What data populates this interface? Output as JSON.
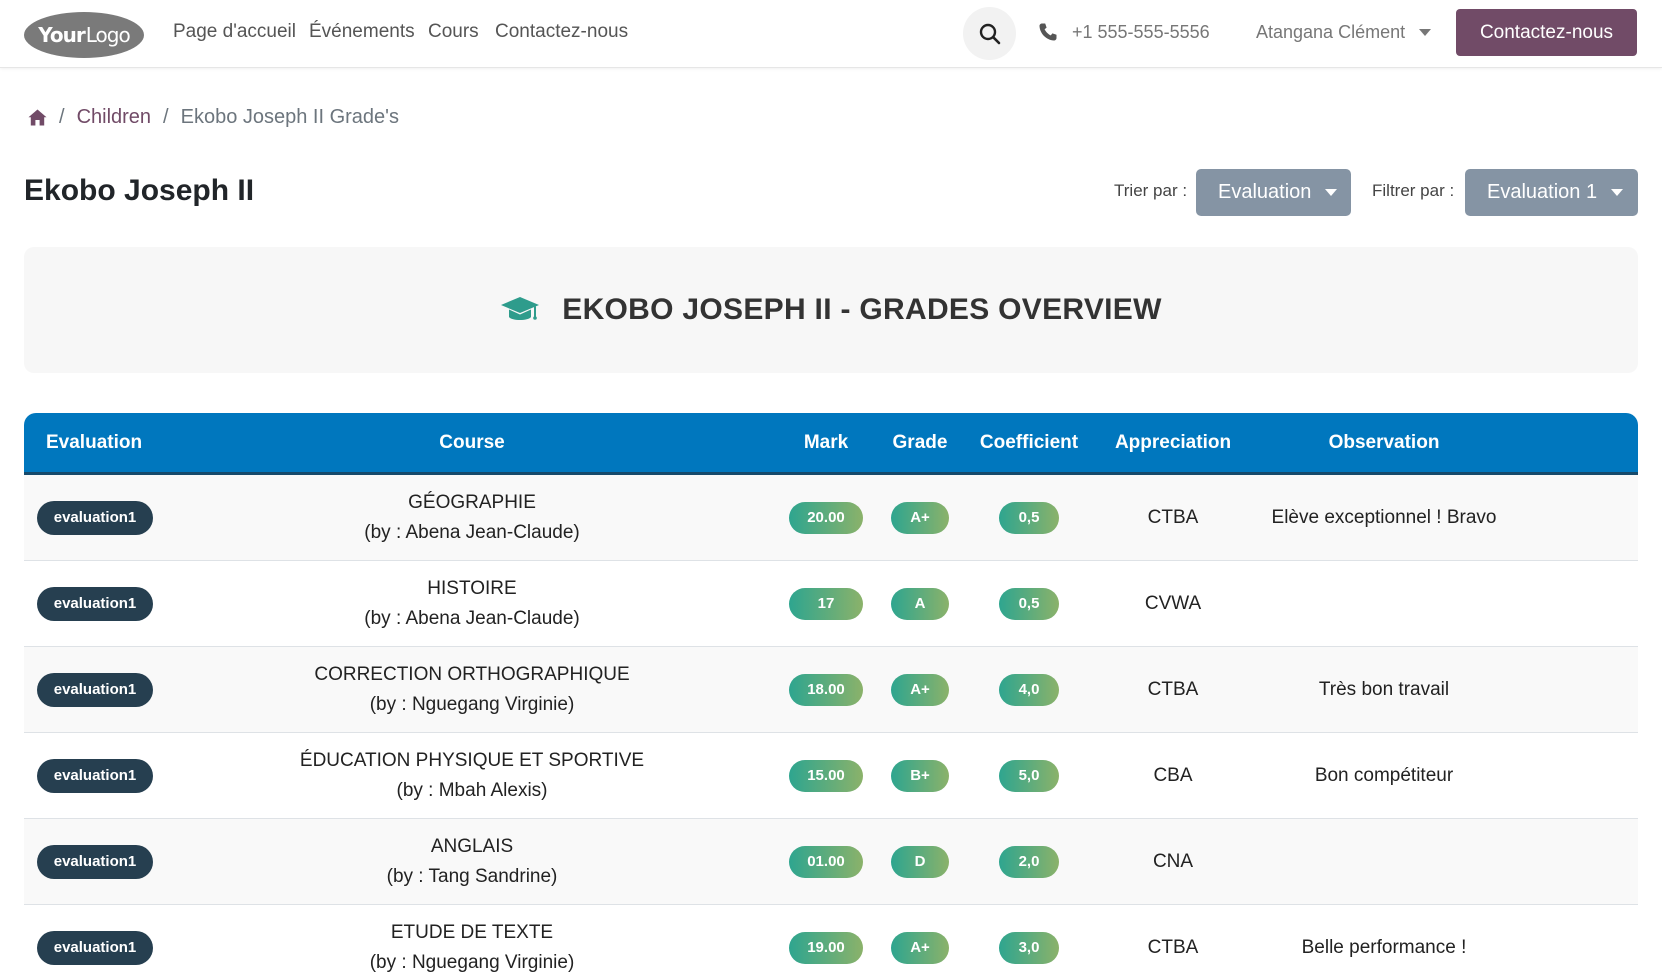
{
  "header": {
    "logo_bold": "Your",
    "logo_light": "Logo",
    "nav": [
      "Page d'accueil",
      "Événements",
      "Cours",
      "Contactez-nous"
    ],
    "phone": "+1 555-555-5556",
    "user": "Atangana Clément",
    "cta": "Contactez-nous"
  },
  "breadcrumb": {
    "children": "Children",
    "current": "Ekobo Joseph II Grade's"
  },
  "page_title": "Ekobo Joseph II",
  "controls": {
    "sort_label": "Trier par :",
    "sort_value": "Evaluation",
    "filter_label": "Filtrer par :",
    "filter_value": "Evaluation 1"
  },
  "overview_title": "EKOBO JOSEPH II - GRADES OVERVIEW",
  "table": {
    "headers": [
      "Evaluation",
      "Course",
      "Mark",
      "Grade",
      "Coefficient",
      "Appreciation",
      "Observation"
    ],
    "rows": [
      {
        "evaluation": "evaluation1",
        "course": "GÉOGRAPHIE",
        "teacher": "(by : Abena Jean-Claude)",
        "mark": "20.00",
        "grade": "A+",
        "coefficient": "0,5",
        "appreciation": "CTBA",
        "observation": "Elève exceptionnel ! Bravo"
      },
      {
        "evaluation": "evaluation1",
        "course": "HISTOIRE",
        "teacher": "(by : Abena Jean-Claude)",
        "mark": "17",
        "grade": "A",
        "coefficient": "0,5",
        "appreciation": "CVWA",
        "observation": ""
      },
      {
        "evaluation": "evaluation1",
        "course": "CORRECTION ORTHOGRAPHIQUE",
        "teacher": "(by : Nguegang Virginie)",
        "mark": "18.00",
        "grade": "A+",
        "coefficient": "4,0",
        "appreciation": "CTBA",
        "observation": "Très bon travail"
      },
      {
        "evaluation": "evaluation1",
        "course": "ÉDUCATION PHYSIQUE ET SPORTIVE",
        "teacher": "(by : Mbah Alexis)",
        "mark": "15.00",
        "grade": "B+",
        "coefficient": "5,0",
        "appreciation": "CBA",
        "observation": "Bon compétiteur"
      },
      {
        "evaluation": "evaluation1",
        "course": "ANGLAIS",
        "teacher": "(by : Tang Sandrine)",
        "mark": "01.00",
        "grade": "D",
        "coefficient": "2,0",
        "appreciation": "CNA",
        "observation": ""
      },
      {
        "evaluation": "evaluation1",
        "course": "ETUDE DE TEXTE",
        "teacher": "(by : Nguegang Virginie)",
        "mark": "19.00",
        "grade": "A+",
        "coefficient": "3,0",
        "appreciation": "CTBA",
        "observation": "Belle performance !"
      }
    ]
  },
  "colors": {
    "brand": "#714b67",
    "table_header": "#0077be",
    "badge": "#263f50",
    "dropdown": "#8594a4",
    "cap_icon": "#2e9c8c"
  },
  "icons": [
    "search-icon",
    "phone-icon",
    "home-icon",
    "graduation-cap-icon",
    "chevron-down-icon"
  ]
}
